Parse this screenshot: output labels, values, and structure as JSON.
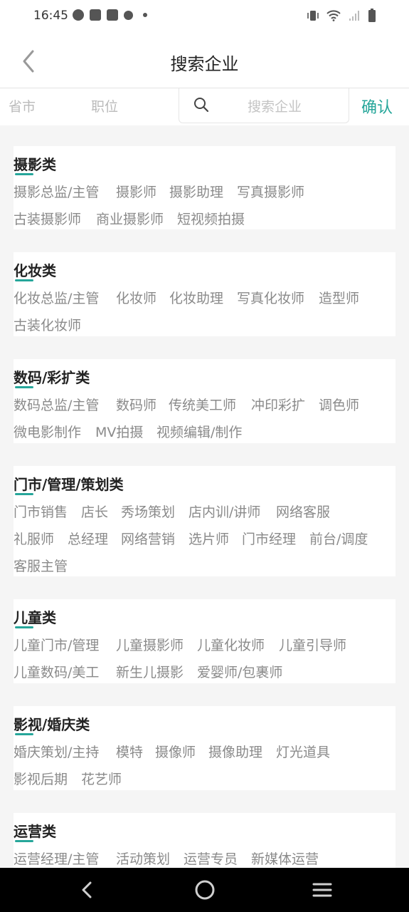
{
  "status_bar": {
    "time": "16:45"
  },
  "header": {
    "title": "搜索企业"
  },
  "filter_bar": {
    "province": "省市",
    "position": "职位",
    "search_placeholder": "搜索企业",
    "confirm": "确认"
  },
  "colors": {
    "accent": "#26a69a",
    "tag_text": "#8a8a8a"
  },
  "categories": [
    {
      "title": "摄影类",
      "tags": [
        "摄影总监/主管",
        "摄影师",
        "摄影助理",
        "写真摄影师",
        "古装摄影师",
        "商业摄影师",
        "短视频拍摄"
      ]
    },
    {
      "title": "化妆类",
      "tags": [
        "化妆总监/主管",
        "化妆师",
        "化妆助理",
        "写真化妆师",
        "造型师",
        "古装化妆师"
      ]
    },
    {
      "title": "数码/彩扩类",
      "tags": [
        "数码总监/主管",
        "数码师",
        "传统美工师",
        "冲印彩扩",
        "调色师",
        "微电影制作",
        "MV拍摄",
        "视频编辑/制作"
      ]
    },
    {
      "title": "门市/管理/策划类",
      "tags": [
        "门市销售",
        "店长",
        "秀场策划",
        "店内训/讲师",
        "网络客服",
        "礼服师",
        "总经理",
        "网络营销",
        "选片师",
        "门市经理",
        "前台/调度",
        "客服主管"
      ]
    },
    {
      "title": "儿童类",
      "tags": [
        "儿童门市/管理",
        "儿童摄影师",
        "儿童化妆师",
        "儿童引导师",
        "儿童数码/美工",
        "新生儿摄影",
        "爱婴师/包裹师"
      ]
    },
    {
      "title": "影视/婚庆类",
      "tags": [
        "婚庆策划/主持",
        "模特",
        "摄像师",
        "摄像助理",
        "灯光道具",
        "影视后期",
        "花艺师"
      ]
    },
    {
      "title": "运营类",
      "tags": [
        "运营经理/主管",
        "活动策划",
        "运营专员",
        "新媒体运营"
      ]
    }
  ]
}
